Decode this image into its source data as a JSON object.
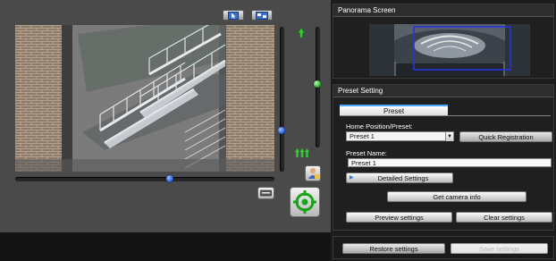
{
  "panorama": {
    "title": "Panorama Screen"
  },
  "preset_setting": {
    "title": "Preset Setting",
    "tab_label": "Preset",
    "home_position_label": "Home Position/Preset:",
    "home_position_value": "Preset 1",
    "quick_registration": "Quick Registration",
    "preset_name_label": "Preset Name:",
    "preset_name_value": "Preset 1",
    "detailed_settings": "Detailed Settings",
    "get_camera_info": "Get camera info",
    "preview_settings": "Preview settings",
    "clear_settings": "Clear settings"
  },
  "footer": {
    "restore_settings": "Restore settings",
    "save_settings": "Save settings"
  },
  "sliders": {
    "pan_position": 0.6,
    "tilt_position": 0.73,
    "zoom_position": 0.47
  }
}
